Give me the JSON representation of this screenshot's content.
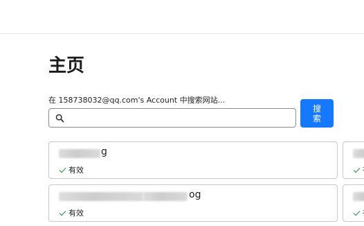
{
  "header": {},
  "page": {
    "title": "主页"
  },
  "search": {
    "label": "在 158738032@qq.com's Account 中搜索网站...",
    "value": "",
    "icon": "search-icon",
    "button_label": "搜 索",
    "button_color": "#1677ff"
  },
  "sites": [
    {
      "name_visible_suffix": "g",
      "status": "有效",
      "status_color": "#2e9d4d"
    },
    {
      "name_visible_suffix": "og",
      "status": "有效",
      "status_color": "#2e9d4d"
    }
  ],
  "partial_cards": [
    {
      "status": "有"
    },
    {
      "status": "有"
    }
  ]
}
